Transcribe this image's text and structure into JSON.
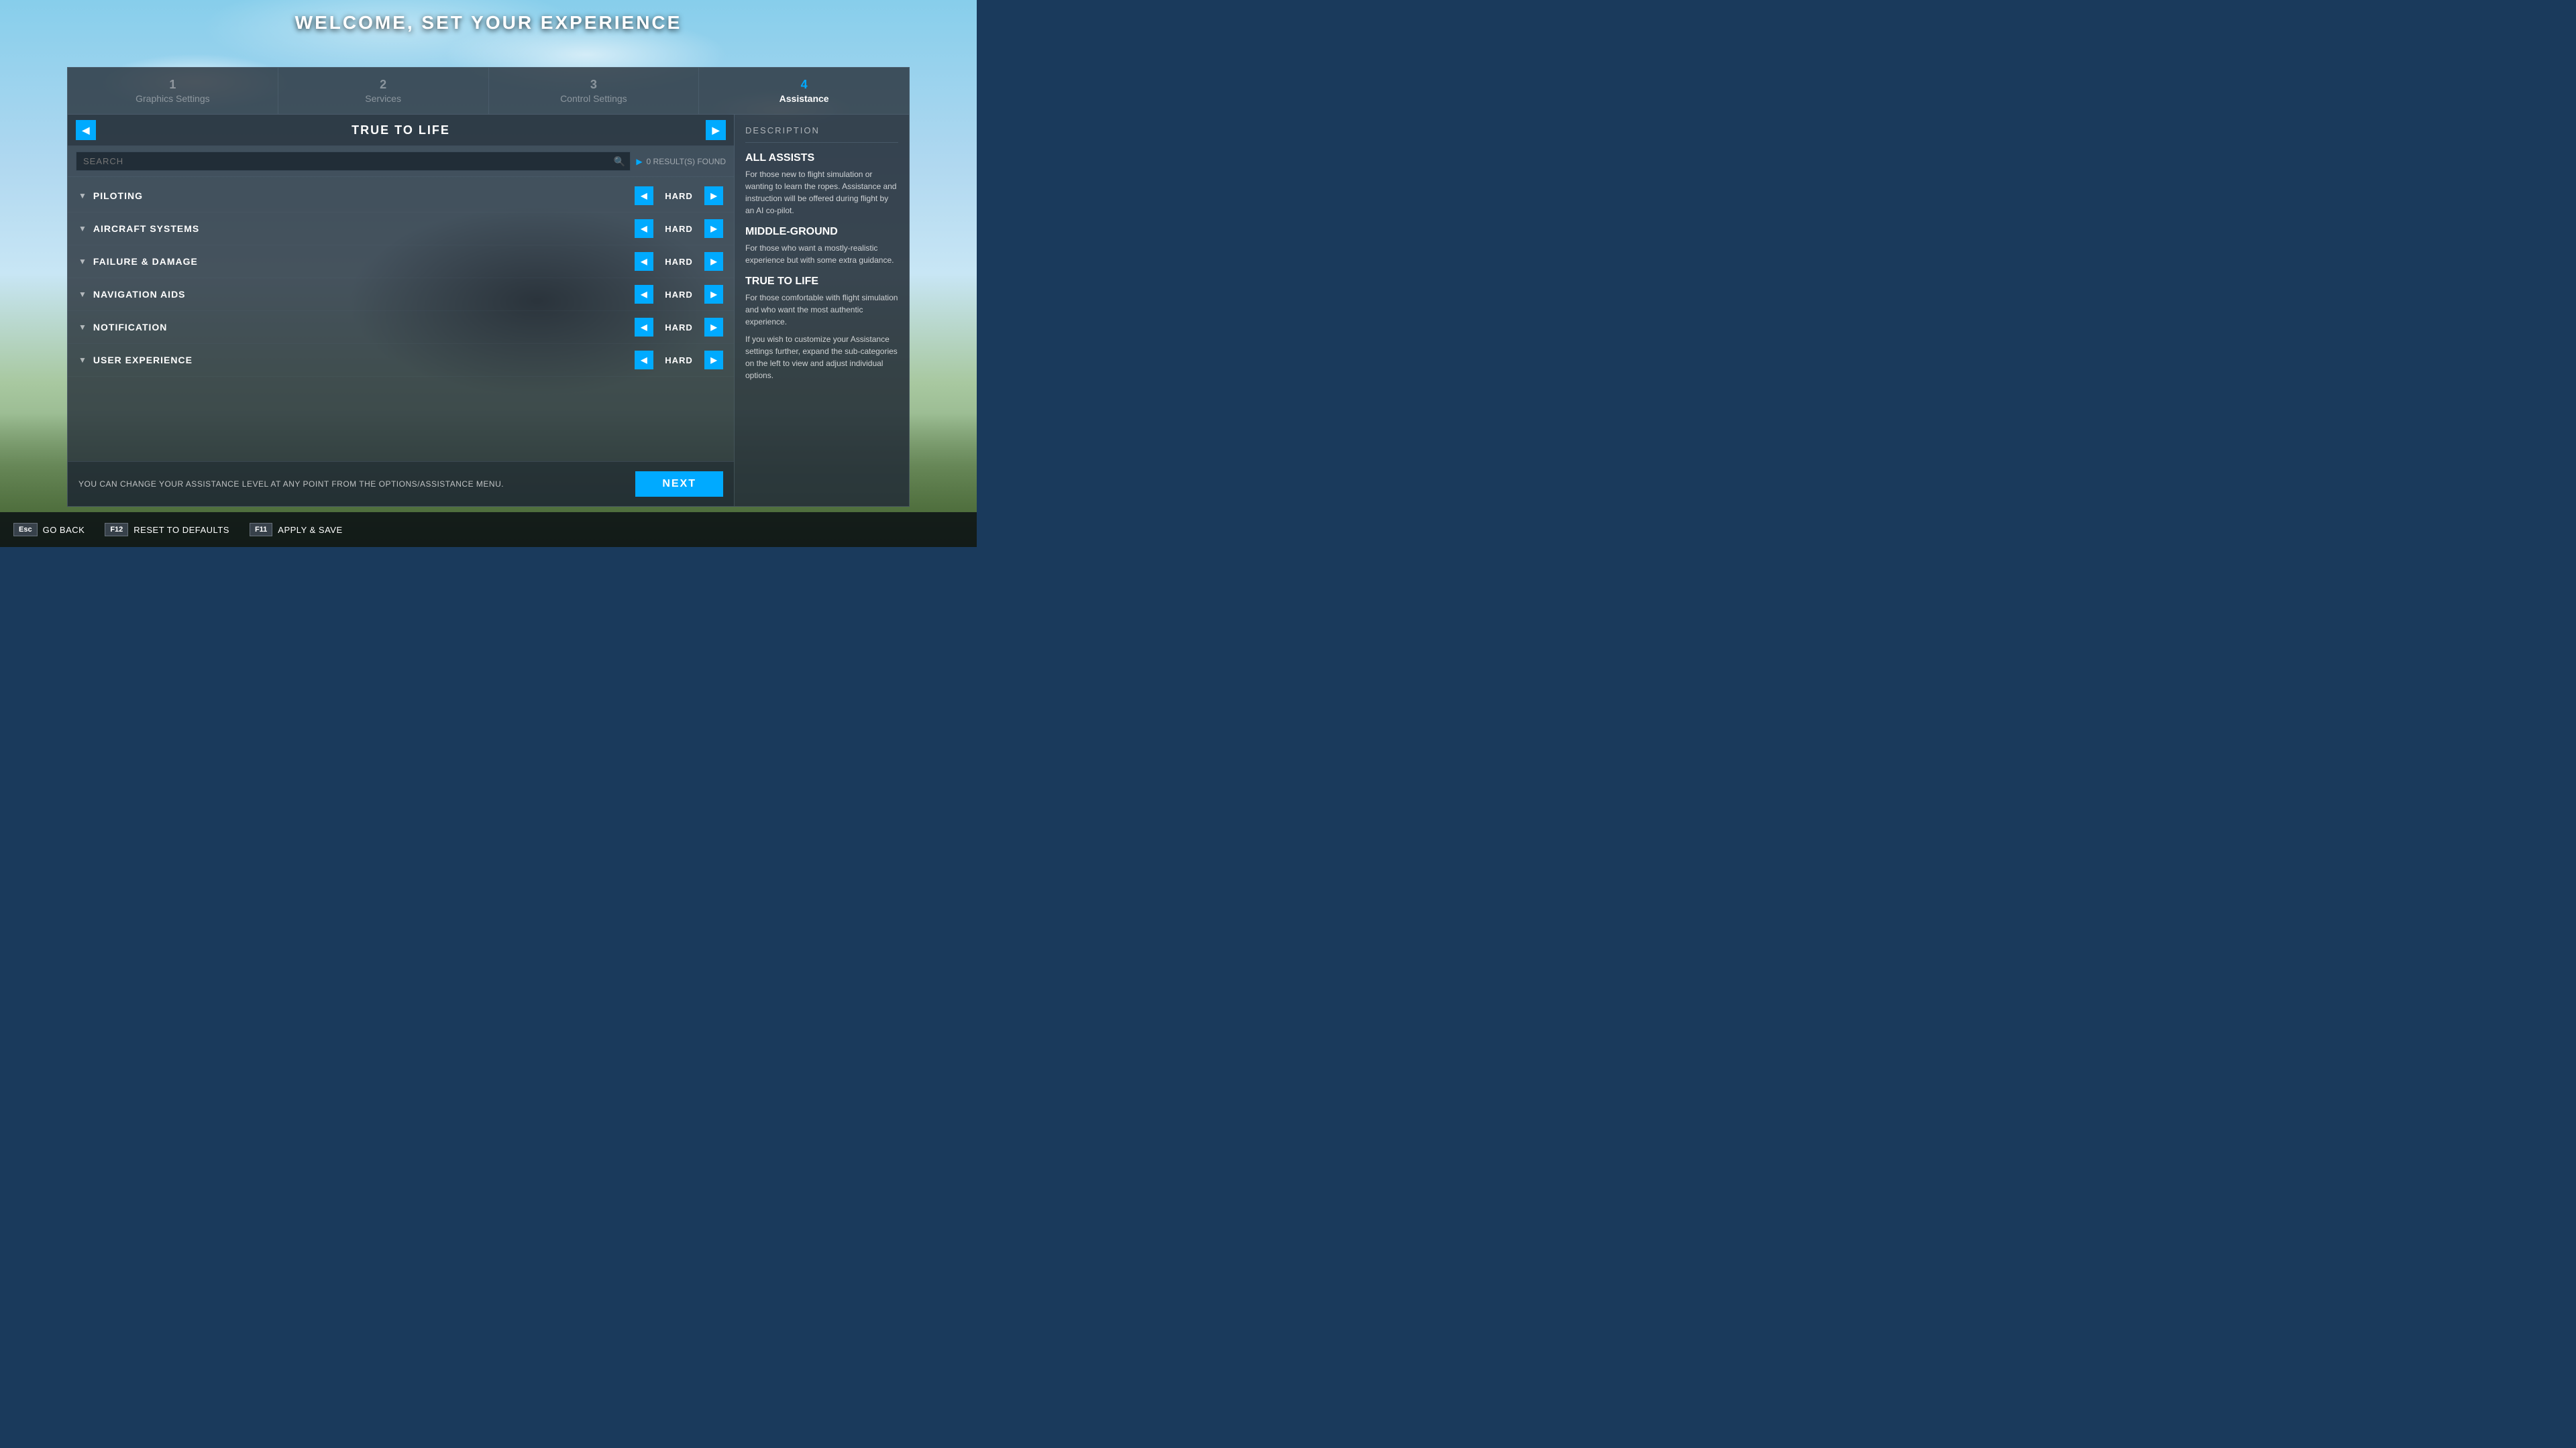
{
  "page": {
    "title": "WELCOME, SET YOUR EXPERIENCE"
  },
  "steps": [
    {
      "number": "1",
      "label": "Graphics Settings",
      "active": false
    },
    {
      "number": "2",
      "label": "Services",
      "active": false
    },
    {
      "number": "3",
      "label": "Control Settings",
      "active": false
    },
    {
      "number": "4",
      "label": "Assistance",
      "active": true
    }
  ],
  "mode": {
    "title": "TRUE TO LIFE",
    "prev_label": "◀",
    "next_label": "▶"
  },
  "search": {
    "placeholder": "SEARCH",
    "results_text": "0 RESULT(S) FOUND"
  },
  "categories": [
    {
      "name": "PILOTING",
      "value": "HARD"
    },
    {
      "name": "AIRCRAFT SYSTEMS",
      "value": "HARD"
    },
    {
      "name": "FAILURE & DAMAGE",
      "value": "HARD"
    },
    {
      "name": "NAVIGATION AIDS",
      "value": "HARD"
    },
    {
      "name": "NOTIFICATION",
      "value": "HARD"
    },
    {
      "name": "USER EXPERIENCE",
      "value": "HARD"
    }
  ],
  "description": {
    "title": "DESCRIPTION",
    "sections": [
      {
        "heading": "ALL ASSISTS",
        "text": "For those new to flight simulation or wanting to learn the ropes. Assistance and instruction will be offered during flight by an AI co-pilot."
      },
      {
        "heading": "MIDDLE-GROUND",
        "text": "For those who want a mostly-realistic experience but with some extra guidance."
      },
      {
        "heading": "TRUE TO LIFE",
        "text": "For those comfortable with flight simulation and who want the most authentic experience."
      },
      {
        "heading": "",
        "text": "If you wish to customize your Assistance settings further, expand the sub-categories on the left to view and adjust individual options."
      }
    ]
  },
  "footer": {
    "note": "YOU CAN CHANGE YOUR ASSISTANCE LEVEL AT ANY POINT FROM THE OPTIONS/ASSISTANCE MENU.",
    "next_label": "NEXT"
  },
  "hotkeys": [
    {
      "key": "Esc",
      "label": "GO BACK"
    },
    {
      "key": "F12",
      "label": "RESET TO DEFAULTS"
    },
    {
      "key": "F11",
      "label": "APPLY & SAVE"
    }
  ]
}
